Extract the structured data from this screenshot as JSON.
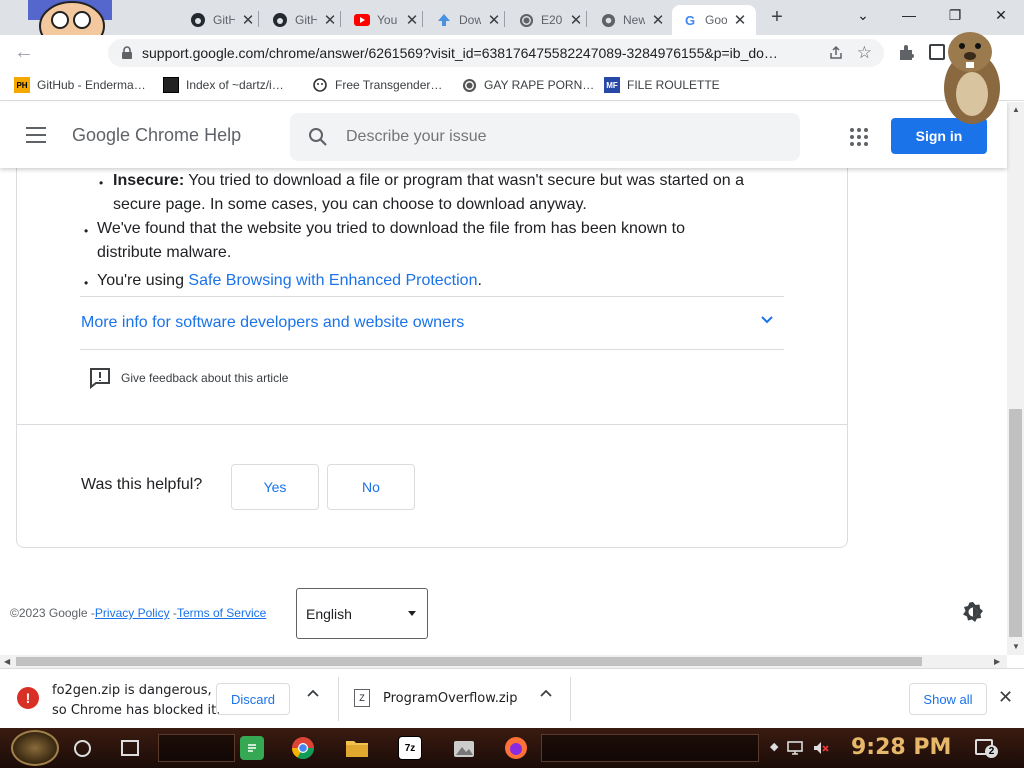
{
  "browser": {
    "tabs": [
      {
        "title": "GitH",
        "icon": "github-icon"
      },
      {
        "title": "GitH",
        "icon": "github-icon"
      },
      {
        "title": "You",
        "icon": "youtube-icon"
      },
      {
        "title": "Dow",
        "icon": "download-arrow-icon"
      },
      {
        "title": "E20",
        "icon": "globe-icon"
      },
      {
        "title": "New",
        "icon": "chrome-icon"
      },
      {
        "title": "Goo",
        "icon": "google-icon"
      }
    ],
    "url": "support.google.com/chrome/answer/6261569?visit_id=638176475582247089-3284976155&p=ib_do…",
    "bookmarks": [
      {
        "label": "GitHub - Enderma…",
        "icon_text": "PH",
        "icon_color": "#f7a800"
      },
      {
        "label": "Index of ~dartz/i…",
        "icon_text": "",
        "icon_color": "#222222"
      },
      {
        "label": "Free Transgender…",
        "icon_text": "",
        "icon_color": "#333333"
      },
      {
        "label": "GAY RAPE PORN…",
        "icon_text": "",
        "icon_color": "#555555"
      },
      {
        "label": "FILE ROULETTE",
        "icon_text": "MF",
        "icon_color": "#2848a8"
      }
    ]
  },
  "header": {
    "title": "Google Chrome Help",
    "search_placeholder": "Describe your issue",
    "sign_in": "Sign in"
  },
  "article": {
    "bullet_insecure_bold": "Insecure:",
    "bullet_insecure_text": " You tried to download a file or program that wasn't secure but was started on a",
    "bullet_insecure_line2": "secure page. In some cases, you can choose to download anyway.",
    "bullet_malware_line1": "We've found that the website you tried to download the file from has been known to",
    "bullet_malware_line2": "distribute malware.",
    "bullet_safe_prefix": "You're using ",
    "bullet_safe_link": "Safe Browsing with Enhanced Protection",
    "bullet_safe_suffix": ".",
    "more_info": "More info for software developers and website owners",
    "feedback": "Give feedback about this article",
    "helpful_question": "Was this helpful?",
    "yes": "Yes",
    "no": "No"
  },
  "footer": {
    "copyright": "©2023 Google -",
    "privacy": "Privacy Policy",
    "sep": " -",
    "terms": "Terms of Service",
    "language": "English"
  },
  "downloads": {
    "blocked_line1": "fo2gen.zip is dangerous,",
    "blocked_line2": "so Chrome has blocked it.",
    "discard": "Discard",
    "file2": "ProgramOverflow.zip",
    "show_all": "Show all"
  },
  "taskbar": {
    "time": "9:28 PM",
    "notifications": "2",
    "apps": [
      {
        "name": "notes-app",
        "label": "",
        "color": "#34a853"
      },
      {
        "name": "chrome-app",
        "label": "",
        "color": "#fbbc04"
      },
      {
        "name": "file-explorer-app",
        "label": "",
        "color": "#f2c14e"
      },
      {
        "name": "7zip-app",
        "label": "7z",
        "color": "#ffffff"
      },
      {
        "name": "photos-app",
        "label": "",
        "color": "#cccccc"
      },
      {
        "name": "firefox-app",
        "label": "",
        "color": "#ff7139"
      }
    ]
  },
  "colors": {
    "accent": "#1a73e8",
    "danger": "#d93025"
  }
}
